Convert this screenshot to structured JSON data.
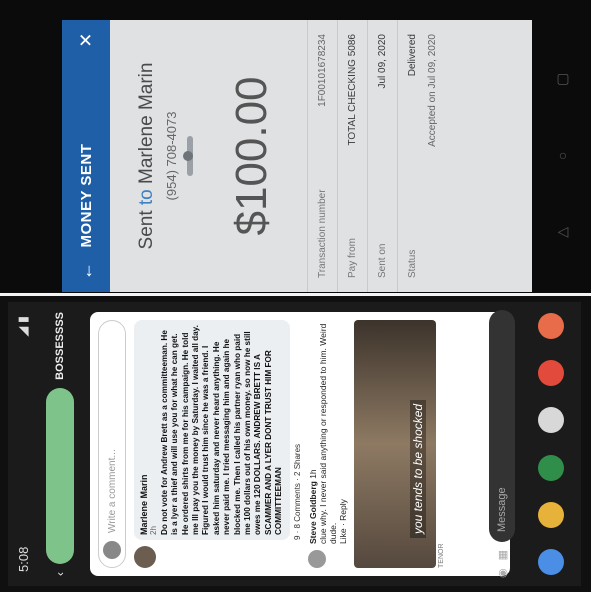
{
  "money_sent": {
    "header_title": "MONEY SENT",
    "back_icon": "←",
    "close_icon": "✕",
    "sent_prefix": "Sent",
    "sent_to": "to",
    "recipient": "Marlene Marin",
    "phone": "(954) 708-4073",
    "amount": "$100.00",
    "rows": [
      {
        "label": "Transaction number",
        "value": "1F00101678234"
      },
      {
        "label": "Pay from",
        "value": "TOTAL CHECKING 5086"
      },
      {
        "label": "Sent on",
        "value": "Jul 09, 2020"
      },
      {
        "label": "Status",
        "value": "Delivered"
      },
      {
        "label": "",
        "value": "Accepted on Jul 09, 2020"
      }
    ]
  },
  "phone_status": {
    "time": "5:08",
    "icons": "◢ ▮"
  },
  "chat": {
    "group_name": "BOSSESSSS",
    "write_comment": "Write a comment..."
  },
  "comment": {
    "author": "Marlene Marin",
    "time": "2h",
    "text": "Do not vote for Andrew Brett as a committeeman. He is a lyer a thief and will use you for what he can get. He ordered shirts from me for his campaign. He told me Ill pay you the money by Saturday. I waited all day. Figured I would trust him since he was a friend. I asked him saturday and never heard anything. He never paid me. I tried messaging him and again he blocked me. Then I called his partner ryan who paid me 100 dollars out of his own money. so now he still owes me 120 DOLLARS. ANDREW BRETT IS A SCAMMER AND A LYER DONT TRUST HIM FOR COMMITTEEMAN",
    "reactions": "9",
    "comments": "8 Comments",
    "shares": "2 Shares"
  },
  "reply": {
    "author": "Steve Goldberg",
    "time": "1h",
    "text": "clue why. I never said anything or responded to him. Weird dude.",
    "actions": [
      "Like",
      "Reply"
    ],
    "meme_caption": "you tends to be shocked",
    "tenor": "TENOR"
  },
  "message_placeholder": "Message"
}
